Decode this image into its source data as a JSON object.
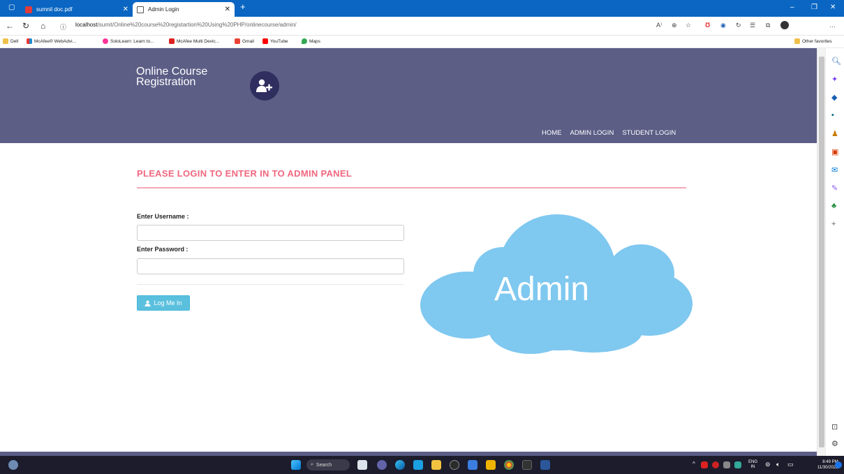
{
  "browser": {
    "tabs": [
      {
        "label": "sumnil doc.pdf",
        "active": false
      },
      {
        "label": "Admin Login",
        "active": true
      }
    ],
    "url_host": "localhost",
    "url_path": "/sumit/Online%20course%20registartion%20Using%20PHP/onlinecourse/admin/",
    "bookmarks": [
      "Dell",
      "McAfee® WebAdvi...",
      "SoloLearn: Learn to...",
      "McAfee Multi Devic...",
      "Gmail",
      "YouTube",
      "Maps"
    ],
    "other_favorites": "Other favorites"
  },
  "site": {
    "brand_line1": "Online Course",
    "brand_line2": "Registration",
    "menu": [
      "HOME",
      "ADMIN LOGIN",
      "STUDENT LOGIN"
    ]
  },
  "login": {
    "heading": "PLEASE LOGIN TO ENTER IN TO ADMIN PANEL",
    "username_label": "Enter Username :",
    "username_value": "",
    "password_label": "Enter Password :",
    "password_value": "",
    "submit_label": "Log Me In"
  },
  "cloud": {
    "text": "Admin",
    "color": "#7fc8f0"
  },
  "taskbar": {
    "search_label": "Search",
    "lang": "ENG",
    "lang_sub": "IN",
    "time": "8:49 PM",
    "date": "11/30/2022"
  },
  "colors": {
    "header": "#5c5e86",
    "accent_heading": "#f0677f",
    "button": "#5bc0de"
  }
}
